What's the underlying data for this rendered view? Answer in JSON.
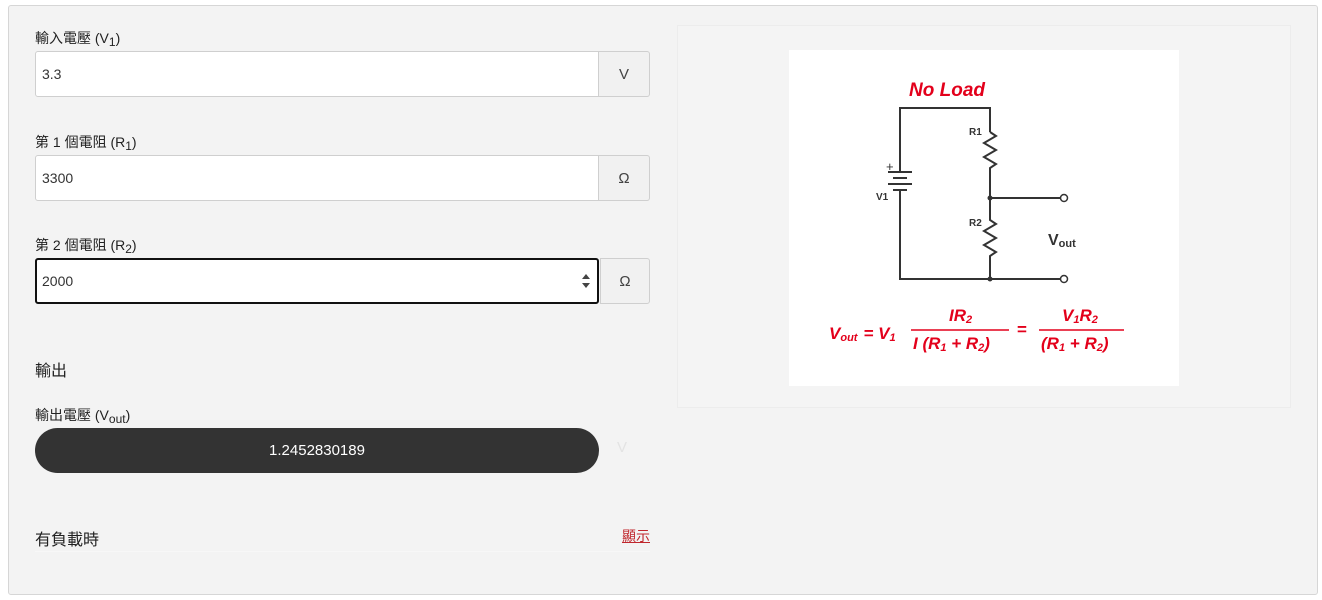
{
  "inputs": {
    "v1": {
      "label_main": "輸入電壓 (V",
      "label_sub": "1",
      "label_tail": ")",
      "value": "3.3",
      "unit": "V"
    },
    "r1": {
      "label_main": "第 1 個電阻 (R",
      "label_sub": "1",
      "label_tail": ")",
      "value": "3300",
      "unit": "Ω"
    },
    "r2": {
      "label_main": "第 2 個電阻 (R",
      "label_sub": "2",
      "label_tail": ")",
      "value": "2000",
      "unit": "Ω"
    }
  },
  "output": {
    "section_title": "輸出",
    "label_main": "輸出電壓 (V",
    "label_sub": "out",
    "label_tail": ")",
    "value": "1.2452830189",
    "unit": "V"
  },
  "load": {
    "label": "有負載時",
    "show_link": "顯示"
  },
  "diagram": {
    "heading": "No Load",
    "r1_label": "R1",
    "r2_label": "R2",
    "v1_label": "V1",
    "plus": "+",
    "vout_main": "V",
    "vout_sub": "out",
    "formula": {
      "lhs_main": "V",
      "lhs_sub": "out",
      "eq1": "= V",
      "eq1_sub": "1",
      "num1": "IR",
      "num1_sub": "2",
      "den1": "I (R",
      "den1_sub_a": "1",
      "den1_mid": " + R",
      "den1_sub_b": "2",
      "den1_tail": ")",
      "eq2": "=",
      "num2_a": "V",
      "num2_sub_a": "1",
      "num2_b": "R",
      "num2_sub_b": "2",
      "den2": "(R",
      "den2_sub_a": "1",
      "den2_mid": " + R",
      "den2_sub_b": "2",
      "den2_tail": ")"
    },
    "accent_color": "#e3001b"
  }
}
